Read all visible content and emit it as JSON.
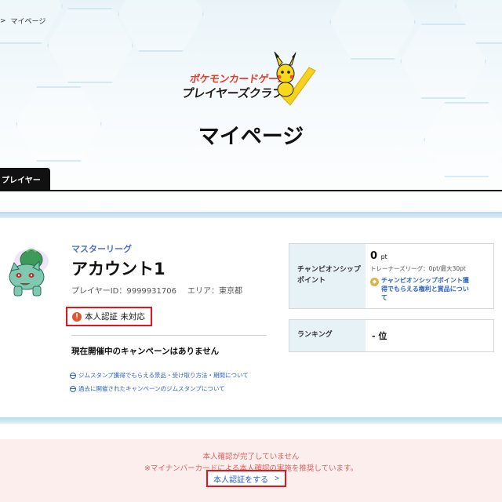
{
  "breadcrumb": {
    "separator": ">",
    "current": "マイページ"
  },
  "logo": {
    "line1": "ポケモンカードゲーム",
    "line2": "プレイヤーズクラブ"
  },
  "page_title": "マイページ",
  "tabs": [
    {
      "label": "プレイヤー",
      "active": true
    }
  ],
  "profile": {
    "league": "マスターリーグ",
    "account_name": "アカウント1",
    "player_id": "プレイヤーID：9999931706",
    "area": "エリア：東京都",
    "verification_status": "本人認証 未対応"
  },
  "campaign": {
    "heading": "現在開催中のキャンペーンはありません",
    "links": [
      "ジムスタンプ獲得でもらえる景品・受け取り方法・期間について",
      "過去に開催されたキャンペーンのジムスタンプについて"
    ]
  },
  "championship": {
    "label_line1": "チャンピオンシップ",
    "label_line2": "ポイント",
    "points": "0",
    "unit": "pt",
    "note": "トレーナーズリーグ：0pt/最大30pt",
    "link_line1": "チャンピオンシップポイント獲",
    "link_line2": "得でもらえる権利と賞品につい",
    "link_line3": "て"
  },
  "ranking": {
    "label": "ランキング",
    "value": "- 位"
  },
  "notice": {
    "line1": "本人確認が完了していません",
    "line2": "※マイナンバーカードによる本人確認の実施を推奨しています。",
    "button_label": "本人認証をする",
    "button_arrow": ">"
  },
  "colors": {
    "accent_blue": "#2c64c4",
    "league_blue": "#4d6fc7",
    "alert_red": "#e3161d",
    "notice_bg": "#fdeeee",
    "notice_text": "#e0605a"
  }
}
